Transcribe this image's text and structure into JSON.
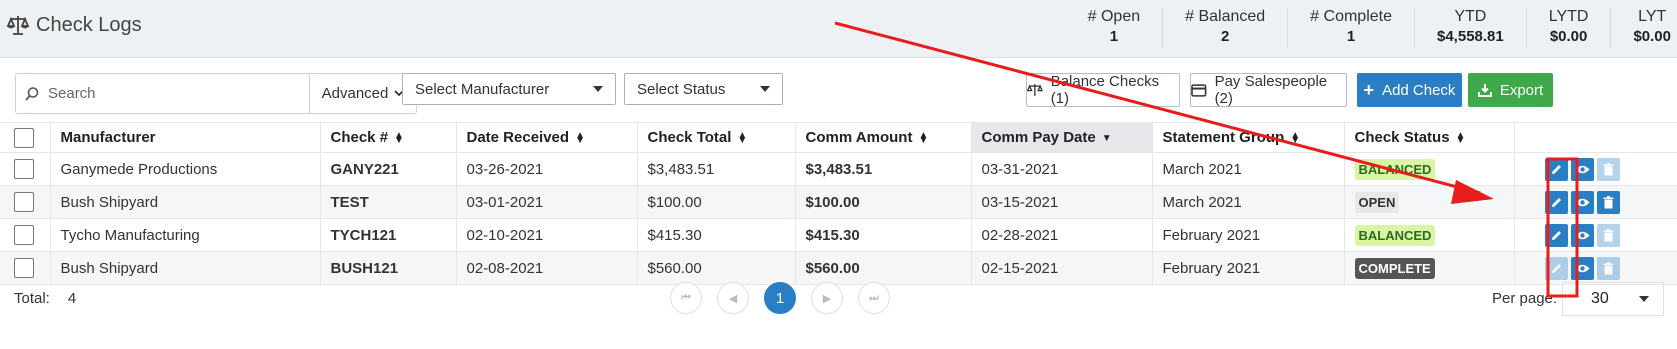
{
  "header": {
    "title": "Check Logs",
    "stats": [
      {
        "label": "# Open",
        "value": "1"
      },
      {
        "label": "# Balanced",
        "value": "2"
      },
      {
        "label": "# Complete",
        "value": "1"
      },
      {
        "label": "YTD",
        "value": "$4,558.81"
      },
      {
        "label": "LYTD",
        "value": "$0.00"
      },
      {
        "label": "LYT",
        "value": "$0.00"
      }
    ]
  },
  "toolbar": {
    "search_placeholder": "Search",
    "advanced_label": "Advanced",
    "manufacturer_select": "Select Manufacturer",
    "status_select": "Select Status",
    "balance_checks_label": "Balance Checks (1)",
    "pay_salespeople_label": "Pay Salespeople (2)",
    "add_check_label": "Add Check",
    "export_label": "Export"
  },
  "table": {
    "columns": [
      "Manufacturer",
      "Check #",
      "Date Received",
      "Check Total",
      "Comm Amount",
      "Comm Pay Date",
      "Statement Group",
      "Check Status"
    ],
    "rows": [
      {
        "manufacturer": "Ganymede Productions",
        "check": "GANY221",
        "date_received": "03-26-2021",
        "check_total": "$3,483.51",
        "comm_amount": "$3,483.51",
        "comm_pay_date": "03-31-2021",
        "statement_group": "March 2021",
        "status": "BALANCED"
      },
      {
        "manufacturer": "Bush Shipyard",
        "check": "TEST",
        "date_received": "03-01-2021",
        "check_total": "$100.00",
        "comm_amount": "$100.00",
        "comm_pay_date": "03-15-2021",
        "statement_group": "March 2021",
        "status": "OPEN"
      },
      {
        "manufacturer": "Tycho Manufacturing",
        "check": "TYCH121",
        "date_received": "02-10-2021",
        "check_total": "$415.30",
        "comm_amount": "$415.30",
        "comm_pay_date": "02-28-2021",
        "statement_group": "February 2021",
        "status": "BALANCED"
      },
      {
        "manufacturer": "Bush Shipyard",
        "check": "BUSH121",
        "date_received": "02-08-2021",
        "check_total": "$560.00",
        "comm_amount": "$560.00",
        "comm_pay_date": "02-15-2021",
        "statement_group": "February 2021",
        "status": "COMPLETE"
      }
    ]
  },
  "footer": {
    "total_label": "Total:",
    "total_value": "4",
    "current_page": "1",
    "per_page_label": "Per page:",
    "per_page_value": "30"
  },
  "colors": {
    "accent": "#2a7fc4",
    "export": "#3ea84a",
    "annotation": "#e81c1c"
  }
}
